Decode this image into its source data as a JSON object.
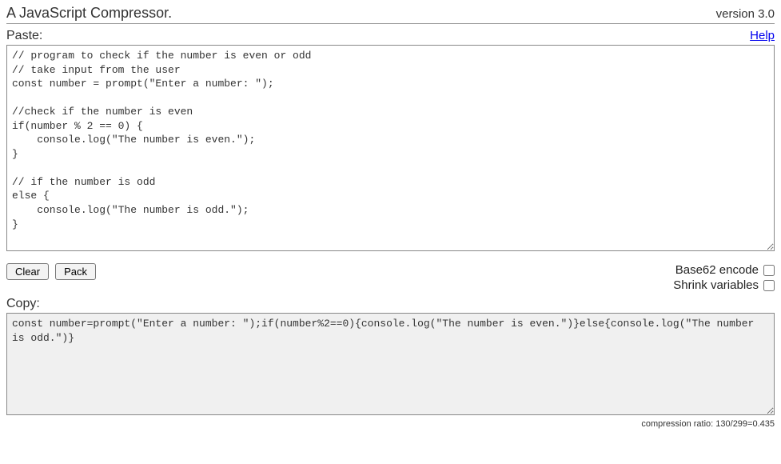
{
  "header": {
    "title": "A JavaScript Compressor.",
    "version": "version 3.0"
  },
  "paste": {
    "label": "Paste:",
    "help_label": "Help",
    "value": "// program to check if the number is even or odd\n// take input from the user\nconst number = prompt(\"Enter a number: \");\n\n//check if the number is even\nif(number % 2 == 0) {\n    console.log(\"The number is even.\");\n}\n\n// if the number is odd\nelse {\n    console.log(\"The number is odd.\");\n}"
  },
  "controls": {
    "clear_label": "Clear",
    "pack_label": "Pack",
    "base62_label": "Base62 encode",
    "base62_checked": false,
    "shrink_label": "Shrink variables",
    "shrink_checked": false
  },
  "copy": {
    "label": "Copy:",
    "value": "const number=prompt(\"Enter a number: \");if(number%2==0){console.log(\"The number is even.\")}else{console.log(\"The number is odd.\")}"
  },
  "footer": {
    "ratio_text": "compression ratio: 130/299=0.435"
  }
}
